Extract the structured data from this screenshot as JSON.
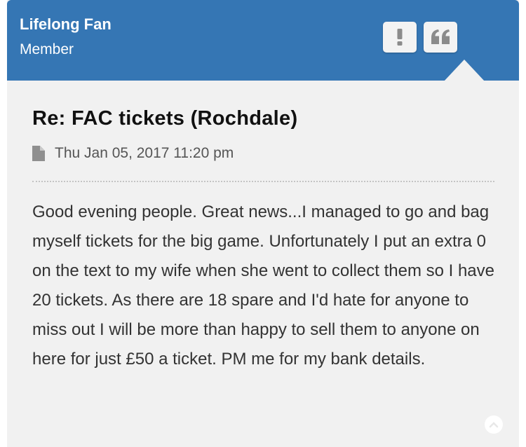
{
  "post": {
    "author": "Lifelong Fan",
    "rank": "Member",
    "title": "Re: FAC tickets (Rochdale)",
    "date": "Thu Jan 05, 2017 11:20 pm",
    "body": "Good evening people. Great news...I managed to go and bag myself tickets for the big game. Unfortunately I put an extra 0 on the text to my wife when she went to collect them so I have 20 tickets. As there are 18 spare and I'd hate for anyone to miss out I will be more than happy to sell them to anyone on here for just £50 a ticket. PM me for my bank details."
  },
  "icons": {
    "report": "exclamation-icon",
    "quote": "quote-icon",
    "post_link": "file-icon",
    "back_to_top": "chevron-up-icon"
  },
  "colors": {
    "header": "#3576b4",
    "card_background": "#f1f1f1",
    "button_icon": "#8b8b8b"
  }
}
